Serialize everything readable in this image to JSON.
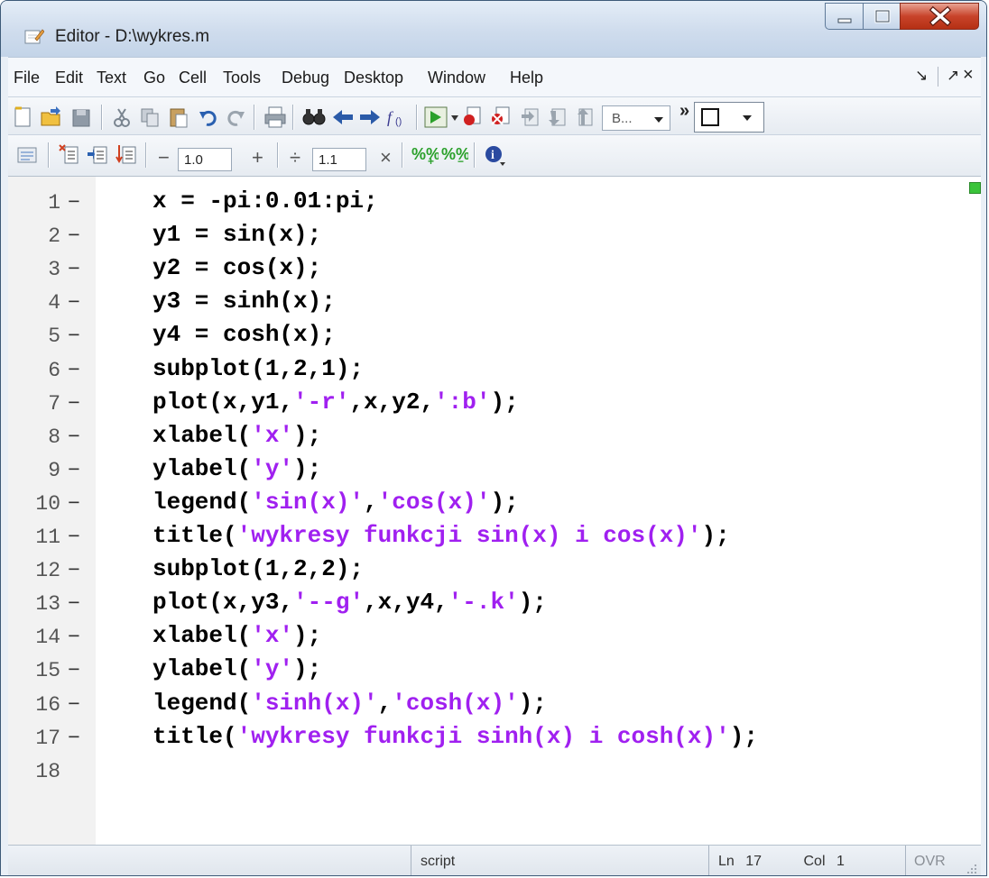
{
  "window": {
    "title": "Editor - D:\\wykres.m"
  },
  "menu": {
    "items": [
      "File",
      "Edit",
      "Text",
      "Go",
      "Cell",
      "Tools",
      "Debug",
      "Desktop",
      "Window",
      "Help"
    ],
    "dock_glyph": "↘",
    "undock_glyph": "↗",
    "close_glyph": "×"
  },
  "toolbar": {
    "style_combo": "B...",
    "overflow": "»"
  },
  "cell_toolbar": {
    "minus": "−",
    "value1": "1.0",
    "plus": "+",
    "divide": "÷",
    "value2": "1.1",
    "times": "×"
  },
  "editor": {
    "breakpoint_dash": "−",
    "lines": [
      {
        "n": "1",
        "parts": [
          {
            "t": "x = -pi:0.01:pi;",
            "s": false
          }
        ]
      },
      {
        "n": "2",
        "parts": [
          {
            "t": "y1 = sin(x);",
            "s": false
          }
        ]
      },
      {
        "n": "3",
        "parts": [
          {
            "t": "y2 = cos(x);",
            "s": false
          }
        ]
      },
      {
        "n": "4",
        "parts": [
          {
            "t": "y3 = sinh(x);",
            "s": false
          }
        ]
      },
      {
        "n": "5",
        "parts": [
          {
            "t": "y4 = cosh(x);",
            "s": false
          }
        ]
      },
      {
        "n": "6",
        "parts": [
          {
            "t": "subplot(1,2,1);",
            "s": false
          }
        ]
      },
      {
        "n": "7",
        "parts": [
          {
            "t": "plot(x,y1,",
            "s": false
          },
          {
            "t": "'-r'",
            "s": true
          },
          {
            "t": ",x,y2,",
            "s": false
          },
          {
            "t": "':b'",
            "s": true
          },
          {
            "t": ");",
            "s": false
          }
        ]
      },
      {
        "n": "8",
        "parts": [
          {
            "t": "xlabel(",
            "s": false
          },
          {
            "t": "'x'",
            "s": true
          },
          {
            "t": ");",
            "s": false
          }
        ]
      },
      {
        "n": "9",
        "parts": [
          {
            "t": "ylabel(",
            "s": false
          },
          {
            "t": "'y'",
            "s": true
          },
          {
            "t": ");",
            "s": false
          }
        ]
      },
      {
        "n": "10",
        "parts": [
          {
            "t": "legend(",
            "s": false
          },
          {
            "t": "'sin(x)'",
            "s": true
          },
          {
            "t": ",",
            "s": false
          },
          {
            "t": "'cos(x)'",
            "s": true
          },
          {
            "t": ");",
            "s": false
          }
        ]
      },
      {
        "n": "11",
        "parts": [
          {
            "t": "title(",
            "s": false
          },
          {
            "t": "'wykresy funkcji sin(x) i cos(x)'",
            "s": true
          },
          {
            "t": ");",
            "s": false
          }
        ]
      },
      {
        "n": "12",
        "parts": [
          {
            "t": "subplot(1,2,2);",
            "s": false
          }
        ]
      },
      {
        "n": "13",
        "parts": [
          {
            "t": "plot(x,y3,",
            "s": false
          },
          {
            "t": "'--g'",
            "s": true
          },
          {
            "t": ",x,y4,",
            "s": false
          },
          {
            "t": "'-.k'",
            "s": true
          },
          {
            "t": ");",
            "s": false
          }
        ]
      },
      {
        "n": "14",
        "parts": [
          {
            "t": "xlabel(",
            "s": false
          },
          {
            "t": "'x'",
            "s": true
          },
          {
            "t": ");",
            "s": false
          }
        ]
      },
      {
        "n": "15",
        "parts": [
          {
            "t": "ylabel(",
            "s": false
          },
          {
            "t": "'y'",
            "s": true
          },
          {
            "t": ");",
            "s": false
          }
        ]
      },
      {
        "n": "16",
        "parts": [
          {
            "t": "legend(",
            "s": false
          },
          {
            "t": "'sinh(x)'",
            "s": true
          },
          {
            "t": ",",
            "s": false
          },
          {
            "t": "'cosh(x)'",
            "s": true
          },
          {
            "t": ");",
            "s": false
          }
        ]
      },
      {
        "n": "17",
        "parts": [
          {
            "t": "title(",
            "s": false
          },
          {
            "t": "'wykresy funkcji sinh(x) i cosh(x)'",
            "s": true
          },
          {
            "t": ");",
            "s": false
          }
        ]
      },
      {
        "n": "18",
        "parts": []
      }
    ]
  },
  "status": {
    "mode": "script",
    "ln_label": "Ln",
    "ln_value": "17",
    "col_label": "Col",
    "col_value": "1",
    "ovr": "OVR"
  },
  "colors": {
    "string": "#a020f0",
    "keyword_text": "#000000",
    "indicator": "#3ac43a"
  }
}
